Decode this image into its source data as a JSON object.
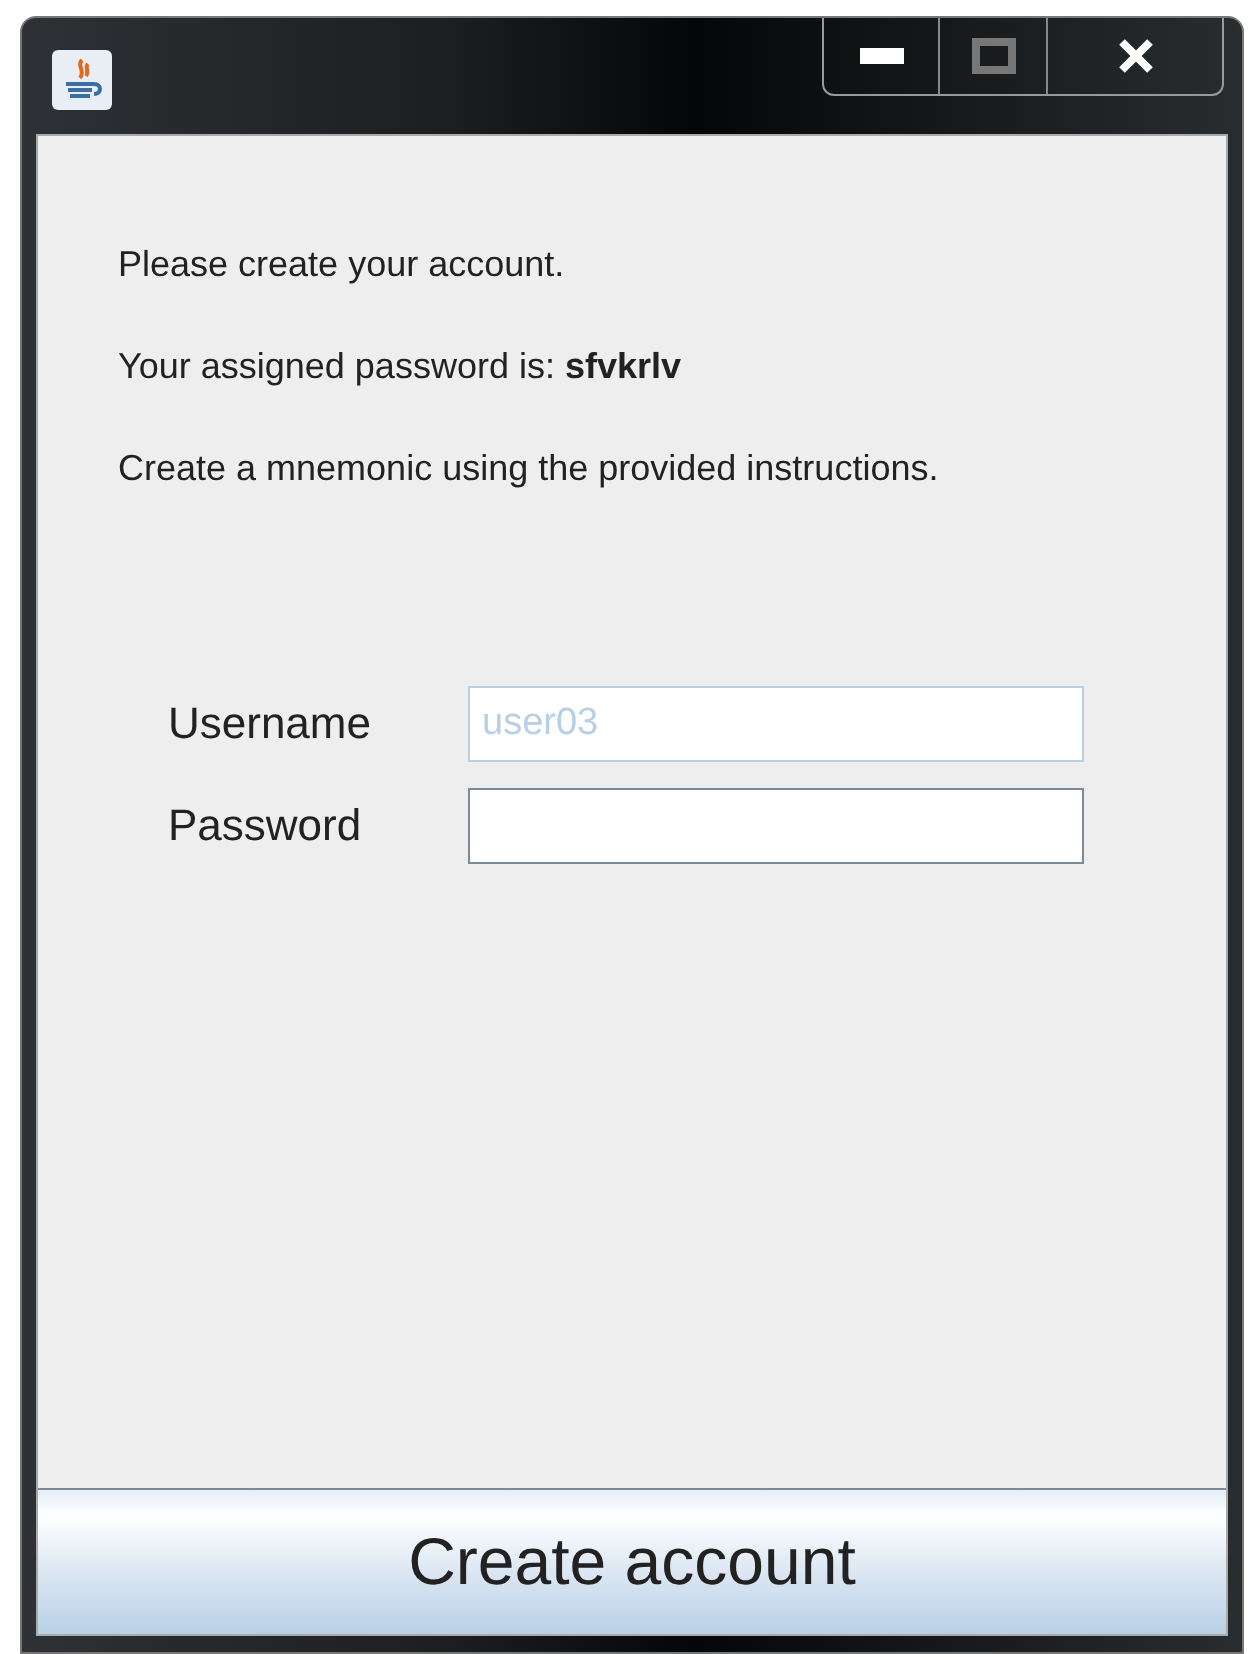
{
  "window": {
    "title_buttons": [
      {
        "kind": "minimize"
      },
      {
        "kind": "maximize"
      },
      {
        "kind": "close"
      }
    ]
  },
  "messages": [
    "Please create your account.",
    "Your assigned password is: **sfvkrlv**",
    "Create a mnemonic using the provided instructions."
  ],
  "fields": [
    {
      "label": "Username",
      "value": "user03",
      "disabled": true
    },
    {
      "label": "Password",
      "disabled": false
    }
  ],
  "button": "Create account"
}
